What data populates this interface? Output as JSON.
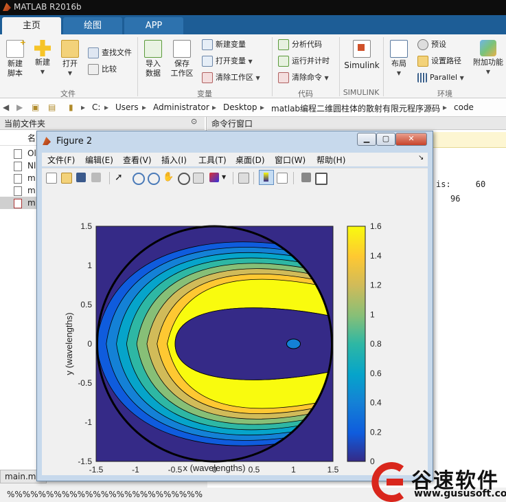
{
  "app": {
    "title": "MATLAB R2016b"
  },
  "tabs": [
    "主页",
    "绘图",
    "APP"
  ],
  "ribbon": {
    "file_group": {
      "label": "文件",
      "new_script": "新建\n脚本",
      "new": "新建",
      "open": "打开",
      "find_files": "查找文件",
      "compare": "比较"
    },
    "variable_group": {
      "label": "变量",
      "import_data": "导入\n数据",
      "save_workspace": "保存\n工作区",
      "new_variable": "新建变量",
      "open_variable": "打开变量",
      "clear_workspace": "清除工作区"
    },
    "code_group": {
      "label": "代码",
      "analyze_code": "分析代码",
      "run_and_time": "运行并计时",
      "clear_commands": "清除命令"
    },
    "simulink_group": {
      "label": "SIMULINK",
      "simulink": "Simulink"
    },
    "environment_group": {
      "label": "环境",
      "layout": "布局",
      "preferences": "预设",
      "set_path": "设置路径",
      "parallel": "Parallel",
      "addons": "附加功能"
    }
  },
  "address": {
    "parts": [
      "C:",
      "Users",
      "Administrator",
      "Desktop",
      "matlab编程二维圆柱体的散射有限元程序源码",
      "code"
    ]
  },
  "current_folder": {
    "title": "当前文件夹",
    "column_header": "名",
    "files": [
      "Ol",
      "Nl",
      "m",
      "m",
      "m"
    ],
    "bottom_tab": "main.m",
    "status": "%%%%%%%%%%%%%%%%%%%%%%%%%"
  },
  "command_window": {
    "title": "命令行窗口",
    "lines": [
      "is:     60",
      "96"
    ]
  },
  "figure": {
    "title": "Figure 2",
    "menus": [
      "文件(F)",
      "编辑(E)",
      "查看(V)",
      "插入(I)",
      "工具(T)",
      "桌面(D)",
      "窗口(W)",
      "帮助(H)"
    ],
    "xlabel": "x (wavelengths)",
    "ylabel": "y (wavelengths)"
  },
  "chart_data": {
    "type": "heatmap",
    "subtype": "filled contour of scattered field magnitude inside circle",
    "xlabel": "x (wavelengths)",
    "ylabel": "y (wavelengths)",
    "xlim": [
      -1.5,
      1.5
    ],
    "ylim": [
      -1.5,
      1.5
    ],
    "x_ticks": [
      "-1.5",
      "-1",
      "-0.5",
      "0",
      "0.5",
      "1",
      "1.5"
    ],
    "y_ticks": [
      "1.5",
      "1",
      "0.5",
      "0",
      "-0.5",
      "-1",
      "-1.5"
    ],
    "colorbar": {
      "range": [
        0,
        1.6
      ],
      "ticks": [
        "1.6",
        "1.4",
        "1.2",
        "1",
        "0.8",
        "0.6",
        "0.4",
        "0.2",
        "0"
      ],
      "colormap": "parula"
    },
    "domain_radius": 1.5,
    "inner_low_region_radius": 0.5,
    "peak_value": 1.6
  },
  "watermark": {
    "brand": "谷速软件",
    "url": "www.gususoft.com"
  },
  "colors": {
    "tab_bar": "#1d5d96",
    "parula_low": "#352a87",
    "parula_high": "#f9fb0e"
  }
}
